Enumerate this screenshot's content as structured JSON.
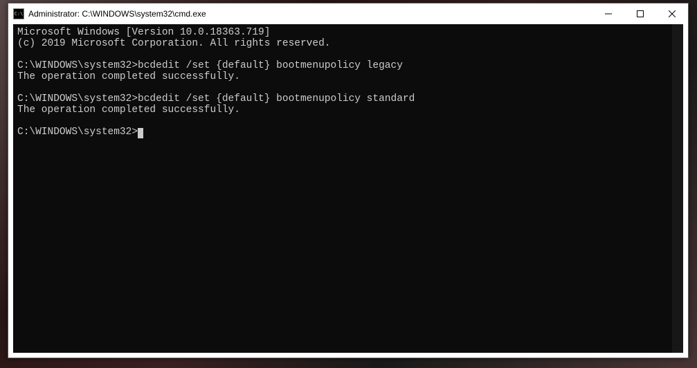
{
  "window": {
    "title": "Administrator: C:\\WINDOWS\\system32\\cmd.exe"
  },
  "terminal": {
    "lines": [
      "Microsoft Windows [Version 10.0.18363.719]",
      "(c) 2019 Microsoft Corporation. All rights reserved.",
      "",
      "C:\\WINDOWS\\system32>bcdedit /set {default} bootmenupolicy legacy",
      "The operation completed successfully.",
      "",
      "C:\\WINDOWS\\system32>bcdedit /set {default} bootmenupolicy standard",
      "The operation completed successfully.",
      "",
      "C:\\WINDOWS\\system32>"
    ],
    "icon_label": "C:\\"
  }
}
